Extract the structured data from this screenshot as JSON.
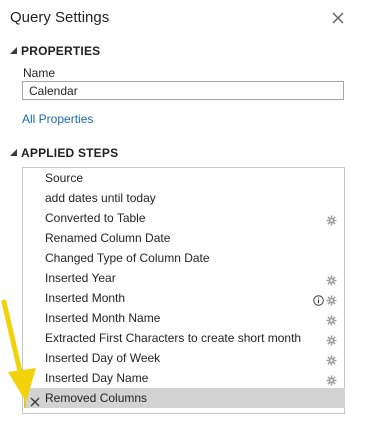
{
  "pane": {
    "title": "Query Settings"
  },
  "properties": {
    "heading": "PROPERTIES",
    "name_label": "Name",
    "name_value": "Calendar",
    "all_properties_link": "All Properties"
  },
  "applied_steps": {
    "heading": "APPLIED STEPS",
    "steps": [
      {
        "label": "Source",
        "icon": "none"
      },
      {
        "label": "add dates until today",
        "icon": "none"
      },
      {
        "label": "Converted to Table",
        "icon": "gear-icon"
      },
      {
        "label": "Renamed Column Date",
        "icon": "none"
      },
      {
        "label": "Changed Type of Column Date",
        "icon": "none"
      },
      {
        "label": "Inserted Year",
        "icon": "gear-icon"
      },
      {
        "label": "Inserted Month",
        "icon": "info-icon+gear-icon"
      },
      {
        "label": "Inserted Month Name",
        "icon": "gear-icon"
      },
      {
        "label": "Extracted First Characters to create short month",
        "icon": "gear-icon"
      },
      {
        "label": "Inserted Day of Week",
        "icon": "gear-icon"
      },
      {
        "label": "Inserted Day Name",
        "icon": "gear-icon"
      },
      {
        "label": "Removed Columns",
        "icon": "delete-x-icon",
        "selected": true
      }
    ]
  },
  "colors": {
    "link": "#1a6ab1",
    "selected_row": "#d3d3d3",
    "annotation_arrow": "#f2d20a",
    "selection_bar": "#e1c233"
  },
  "annotation": {
    "icon": "yellow-arrow-icon"
  }
}
